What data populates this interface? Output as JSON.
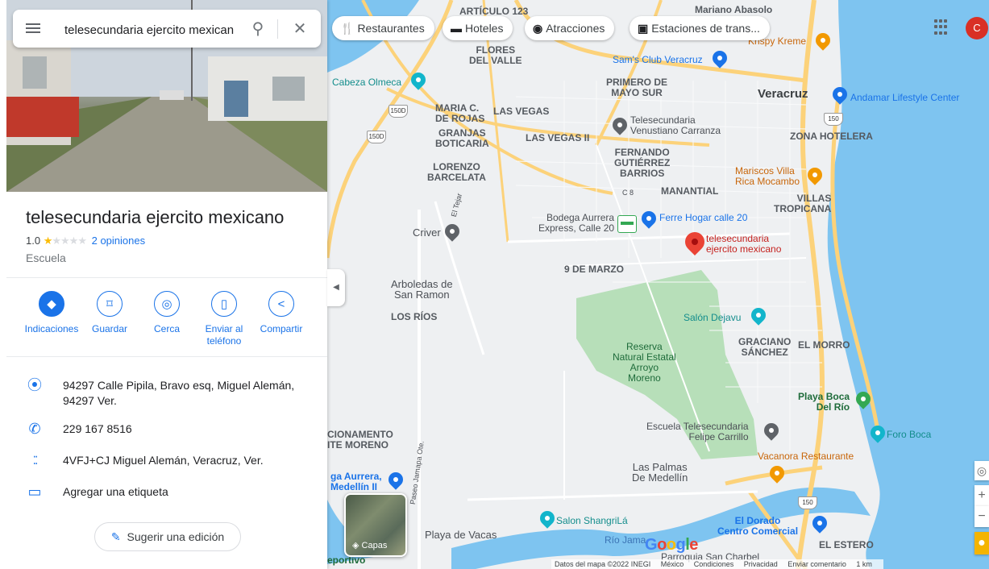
{
  "search": {
    "value": "telesecundaria ejercito mexicano"
  },
  "place": {
    "title": "telesecundaria ejercito mexicano",
    "rating": "1.0",
    "reviews": "2 opiniones",
    "category": "Escuela",
    "address": "94297 Calle Pipila, Bravo esq, Miguel Alemán, 94297 Ver.",
    "phone": "229 167 8516",
    "plus_code": "4VFJ+CJ Miguel Alemán, Veracruz, Ver.",
    "label_action": "Agregar una etiqueta",
    "suggest_edit": "Sugerir una edición"
  },
  "actions": [
    {
      "label": "Indicaciones",
      "icon": "directions-icon"
    },
    {
      "label": "Guardar",
      "icon": "bookmark-icon"
    },
    {
      "label": "Cerca",
      "icon": "nearby-icon"
    },
    {
      "label": "Enviar al teléfono",
      "icon": "send-to-phone-icon"
    },
    {
      "label": "Compartir",
      "icon": "share-icon"
    }
  ],
  "chips": [
    "Restaurantes",
    "Hoteles",
    "Atracciones",
    "Estaciones de trans..."
  ],
  "avatar": "C",
  "layers_label": "Capas",
  "google_logo": "Google",
  "footer": [
    "Datos del mapa ©2022 INEGI",
    "México",
    "Condiciones",
    "Privacidad",
    "Enviar comentario",
    "1 km"
  ],
  "map_labels": {
    "articulo": "ARTÍCULO 123",
    "abasolo": "Mariano Abasolo",
    "flores": "FLORES\nDEL VALLE",
    "sams": "Sam's Club Veracruz",
    "krispy": "Krispy Kreme",
    "cabeza": "Cabeza Olmeca",
    "primero": "PRIMERO DE\nMAYO SUR",
    "veracruz": "Veracruz",
    "andamar": "Andamar Lifestyle Center",
    "maria": "MARIA C.\nDE ROJAS",
    "vegas": "LAS VEGAS",
    "granjas": "GRANJAS\nBOTICARIA",
    "vegas2": "LAS VEGAS II",
    "tele_vc": "Telesecundaria\nVenustiano Carranza",
    "zona": "ZONA HOTELERA",
    "fernando": "FERNANDO\nGUTIÉRREZ\nBARRIOS",
    "lorenzo": "LORENZO\nBARCELATA",
    "mariscos": "Mariscos Villa\nRica Mocambo",
    "c8": "C 8",
    "manantial": "MANANTIAL",
    "villas": "VILLAS\nTROPICANA",
    "bodega": "Bodega Aurrera\nExpress, Calle 20",
    "ferre": "Ferre Hogar calle 20",
    "criver": "Criver",
    "tejar": "El Tejar",
    "target": "telesecundaria\nejercito mexicano",
    "marzo": "9 DE MARZO",
    "arboledas": "Arboledas de\nSan Ramon",
    "rios": "LOS RÍOS",
    "dejavu": "Salón Dejavu",
    "graciano": "GRACIANO\nSÁNCHEZ",
    "morro": "EL MORRO",
    "reserva": "Reserva\nNatural Estatal\nArroyo\nMoreno",
    "playaboca": "Playa Boca\nDel Río",
    "escuela_fc": "Escuela Telesecundaria\nFelipe Carrillo",
    "foroboca": "Foro Boca",
    "cionamento": "CIONAMENTO\nITE MORENO",
    "vacanora": "Vacanora Restaurante",
    "aurrera": "ga Aurrera,\nMedellín II",
    "jamapa": "Paseo Jamapa Ote.",
    "palmas": "Las Palmas\nDe Medellín",
    "dorado": "El Dorado\nCentro Comercial",
    "shangri": "Salon ShangriLá",
    "playavacas": "Playa de Vacas",
    "riojama": "Río Jama",
    "estero": "EL ESTERO",
    "charbel": "Parroquia San Charbel",
    "deportivo": "eportivo",
    "s150": "150D",
    "s150b": "150"
  },
  "colors": {
    "accent": "#1a73e8",
    "road": "#fcd27a",
    "water": "#7ec4f0",
    "park": "#b7dfb9",
    "pin": "#ea4335"
  }
}
